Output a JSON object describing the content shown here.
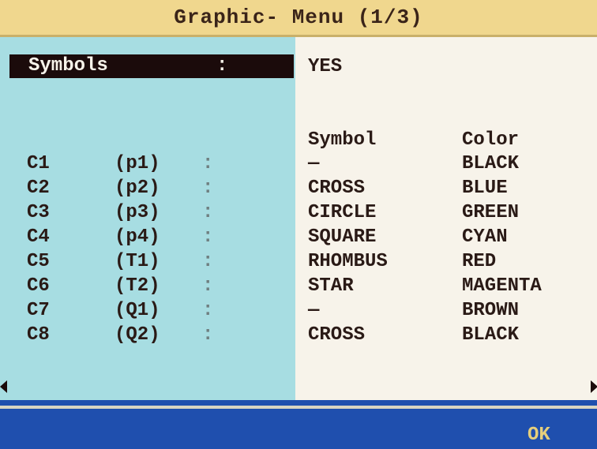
{
  "header": {
    "title": "Graphic- Menu (1/3)"
  },
  "symbols": {
    "label": "Symbols",
    "colon": ":",
    "value": "YES"
  },
  "columns": {
    "symbol": "Symbol",
    "color": "Color"
  },
  "rows": [
    {
      "channel": "C1",
      "param": "(p1)",
      "colon": ":",
      "symbol": "—",
      "color": "BLACK"
    },
    {
      "channel": "C2",
      "param": "(p2)",
      "colon": ":",
      "symbol": "CROSS",
      "color": "BLUE"
    },
    {
      "channel": "C3",
      "param": "(p3)",
      "colon": ":",
      "symbol": "CIRCLE",
      "color": "GREEN"
    },
    {
      "channel": "C4",
      "param": "(p4)",
      "colon": ":",
      "symbol": "SQUARE",
      "color": "CYAN"
    },
    {
      "channel": "C5",
      "param": "(T1)",
      "colon": ":",
      "symbol": "RHOMBUS",
      "color": "RED"
    },
    {
      "channel": "C6",
      "param": "(T2)",
      "colon": ":",
      "symbol": "STAR",
      "color": "MAGENTA"
    },
    {
      "channel": "C7",
      "param": "(Q1)",
      "colon": ":",
      "symbol": "—",
      "color": "BROWN"
    },
    {
      "channel": "C8",
      "param": "(Q2)",
      "colon": ":",
      "symbol": "CROSS",
      "color": "BLACK"
    }
  ],
  "footer": {
    "ok_label": "OK"
  },
  "icons": {
    "left": "arrow-left-icon",
    "right": "arrow-right-icon"
  },
  "colors": {
    "title_bg": "#f0d78e",
    "left_panel": "#a7dde2",
    "right_panel": "#f7f3ea",
    "footer": "#1f4fae",
    "ok": "#e6cf7c"
  }
}
